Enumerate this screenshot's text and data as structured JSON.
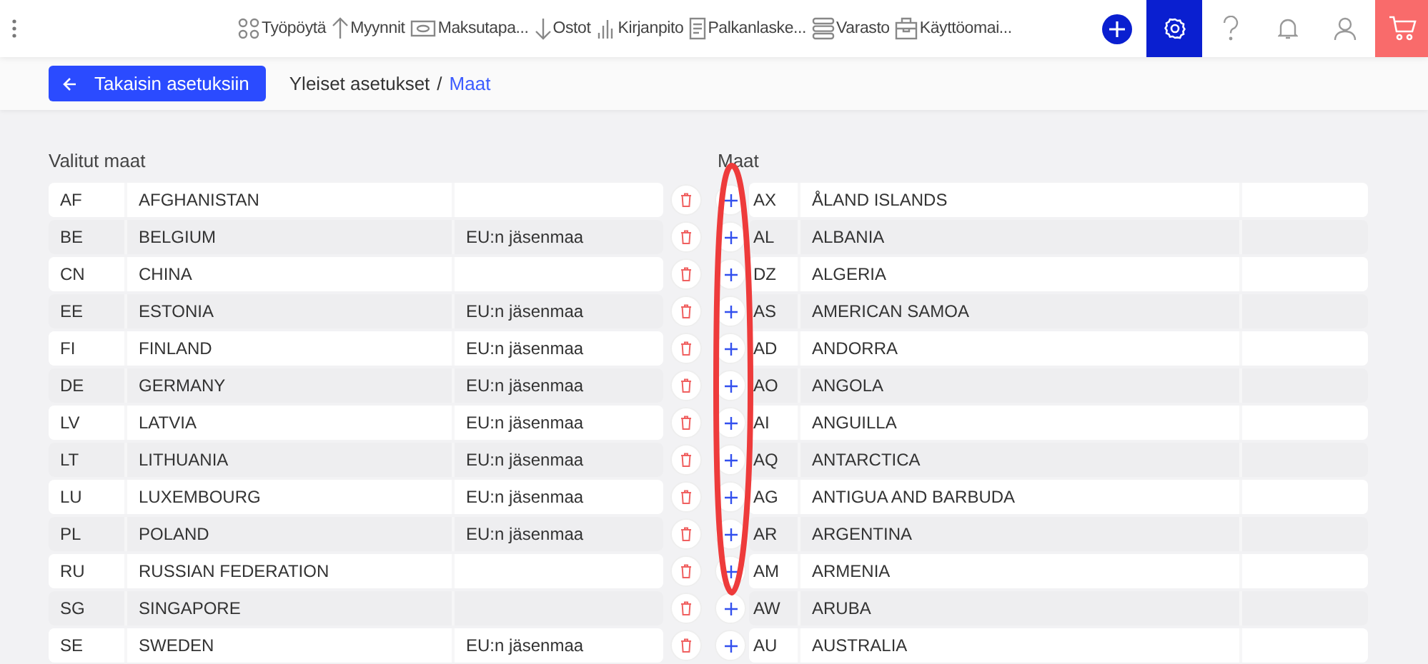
{
  "nav": [
    {
      "label": "Työpöytä",
      "kind": "dots"
    },
    {
      "label": "Myynnit",
      "kind": "arrow-up"
    },
    {
      "label": "Maksutapa...",
      "kind": "card"
    },
    {
      "label": "Ostot",
      "kind": "arrow-down"
    },
    {
      "label": "Kirjanpito",
      "kind": "bars"
    },
    {
      "label": "Palkanlaske...",
      "kind": "document"
    },
    {
      "label": "Varasto",
      "kind": "stack"
    },
    {
      "label": "Käyttöomai...",
      "kind": "briefcase"
    }
  ],
  "back_button": "Takaisin asetuksiin",
  "breadcrumb": [
    {
      "label": "Yleiset asetukset",
      "current": false
    },
    {
      "label": "Maat",
      "current": true
    }
  ],
  "breadcrumb_separator": "/",
  "selected_countries": {
    "title": "Valitut maat",
    "rows": [
      {
        "code": "AF",
        "name": "AFGHANISTAN",
        "note": ""
      },
      {
        "code": "BE",
        "name": "BELGIUM",
        "note": "EU:n jäsenmaa"
      },
      {
        "code": "CN",
        "name": "CHINA",
        "note": ""
      },
      {
        "code": "EE",
        "name": "ESTONIA",
        "note": "EU:n jäsenmaa"
      },
      {
        "code": "FI",
        "name": "FINLAND",
        "note": "EU:n jäsenmaa"
      },
      {
        "code": "DE",
        "name": "GERMANY",
        "note": "EU:n jäsenmaa"
      },
      {
        "code": "LV",
        "name": "LATVIA",
        "note": "EU:n jäsenmaa"
      },
      {
        "code": "LT",
        "name": "LITHUANIA",
        "note": "EU:n jäsenmaa"
      },
      {
        "code": "LU",
        "name": "LUXEMBOURG",
        "note": "EU:n jäsenmaa"
      },
      {
        "code": "PL",
        "name": "POLAND",
        "note": "EU:n jäsenmaa"
      },
      {
        "code": "RU",
        "name": "RUSSIAN FEDERATION",
        "note": ""
      },
      {
        "code": "SG",
        "name": "SINGAPORE",
        "note": ""
      },
      {
        "code": "SE",
        "name": "SWEDEN",
        "note": "EU:n jäsenmaa"
      }
    ]
  },
  "available_countries": {
    "title": "Maat",
    "rows": [
      {
        "code": "AX",
        "name": "ÅLAND ISLANDS"
      },
      {
        "code": "AL",
        "name": "ALBANIA"
      },
      {
        "code": "DZ",
        "name": "ALGERIA"
      },
      {
        "code": "AS",
        "name": "AMERICAN SAMOA"
      },
      {
        "code": "AD",
        "name": "ANDORRA"
      },
      {
        "code": "AO",
        "name": "ANGOLA"
      },
      {
        "code": "AI",
        "name": "ANGUILLA"
      },
      {
        "code": "AQ",
        "name": "ANTARCTICA"
      },
      {
        "code": "AG",
        "name": "ANTIGUA AND BARBUDA"
      },
      {
        "code": "AR",
        "name": "ARGENTINA"
      },
      {
        "code": "AM",
        "name": "ARMENIA"
      },
      {
        "code": "AW",
        "name": "ARUBA"
      },
      {
        "code": "AU",
        "name": "AUSTRALIA"
      }
    ]
  },
  "annotation": {
    "kind": "ellipse"
  }
}
